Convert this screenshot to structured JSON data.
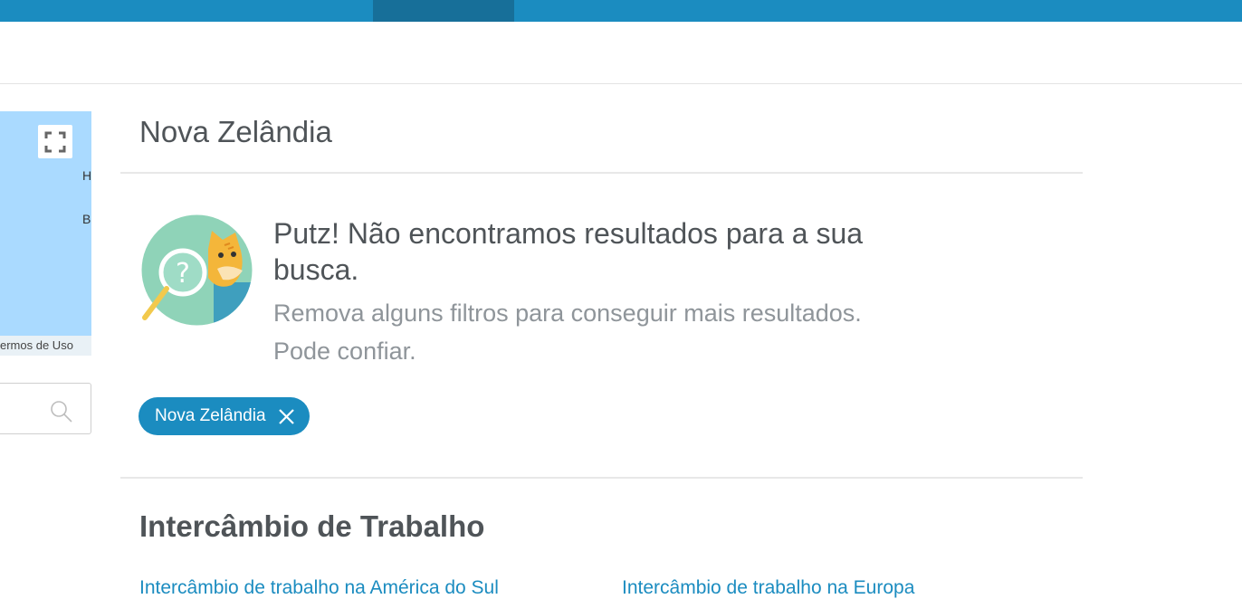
{
  "map": {
    "labels": [
      "H",
      "B"
    ],
    "terms_text": "ermos de Uso"
  },
  "main": {
    "title": "Nova Zelândia",
    "empty_state": {
      "title": "Putz! Não encontramos resultados para a sua busca.",
      "subtitle": "Remova alguns filtros para conseguir mais resultados. Pode confiar."
    },
    "filter_chip": {
      "label": "Nova Zelândia"
    },
    "section": {
      "title": "Intercâmbio de Trabalho",
      "links": [
        "Intercâmbio de trabalho na América do Sul",
        "Intercâmbio de trabalho na Europa"
      ]
    }
  },
  "colors": {
    "brand": "#1b8cc0",
    "brand_dark": "#176f99",
    "map_water": "#aadaff",
    "illustration_bg": "#8fd3b8"
  }
}
